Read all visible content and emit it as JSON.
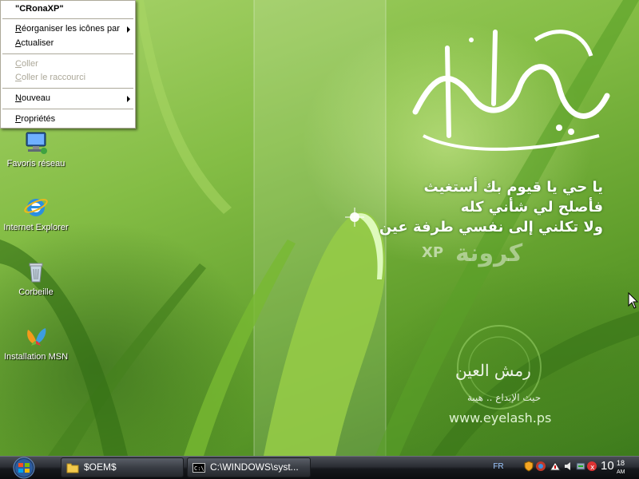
{
  "context_menu": {
    "title": "\"CRonaXP\"",
    "items": [
      {
        "label": "Réorganiser les icônes par",
        "has_submenu": true,
        "enabled": true
      },
      {
        "label": "Actualiser",
        "has_submenu": false,
        "enabled": true
      },
      {
        "label": "Coller",
        "has_submenu": false,
        "enabled": false
      },
      {
        "label": "Coller le raccourci",
        "has_submenu": false,
        "enabled": false
      },
      {
        "label": "Nouveau",
        "has_submenu": true,
        "enabled": true
      },
      {
        "label": "Propriétés",
        "has_submenu": false,
        "enabled": true
      }
    ]
  },
  "desktop_icons": [
    {
      "label": "Favoris réseau",
      "icon": "network-places-icon"
    },
    {
      "label": "Internet Explorer",
      "icon": "internet-explorer-icon"
    },
    {
      "label": "Corbeille",
      "icon": "recycle-bin-icon"
    },
    {
      "label": "Installation MSN",
      "icon": "msn-butterfly-icon"
    }
  ],
  "wallpaper": {
    "calligraphy": "يا حي يا قيوم",
    "line1": "يا حي يا قيوم بك أستغيث",
    "line2": "فأصلح لي شأني كله",
    "line3": "ولا تكلني إلى نفسي طرفة عين",
    "brand_ar": "كرونة",
    "brand_xp": "XP",
    "studio_ar": "رمش العين",
    "studio_sub": "حيث الإبداع .. هيبة",
    "website": "www.eyelash.ps"
  },
  "taskbar": {
    "buttons": [
      {
        "label": "$OEM$",
        "icon": "folder-icon"
      },
      {
        "label": "C:\\WINDOWS\\syst...",
        "icon": "command-prompt-icon"
      }
    ],
    "language": "FR",
    "clock": {
      "hour_min": "10",
      "minutes": "18",
      "ampm": "AM"
    }
  },
  "colors": {
    "menu_disabled": "#aca899",
    "taskbar_dark": "#16181c",
    "wallpaper_green": "#84bd45"
  }
}
